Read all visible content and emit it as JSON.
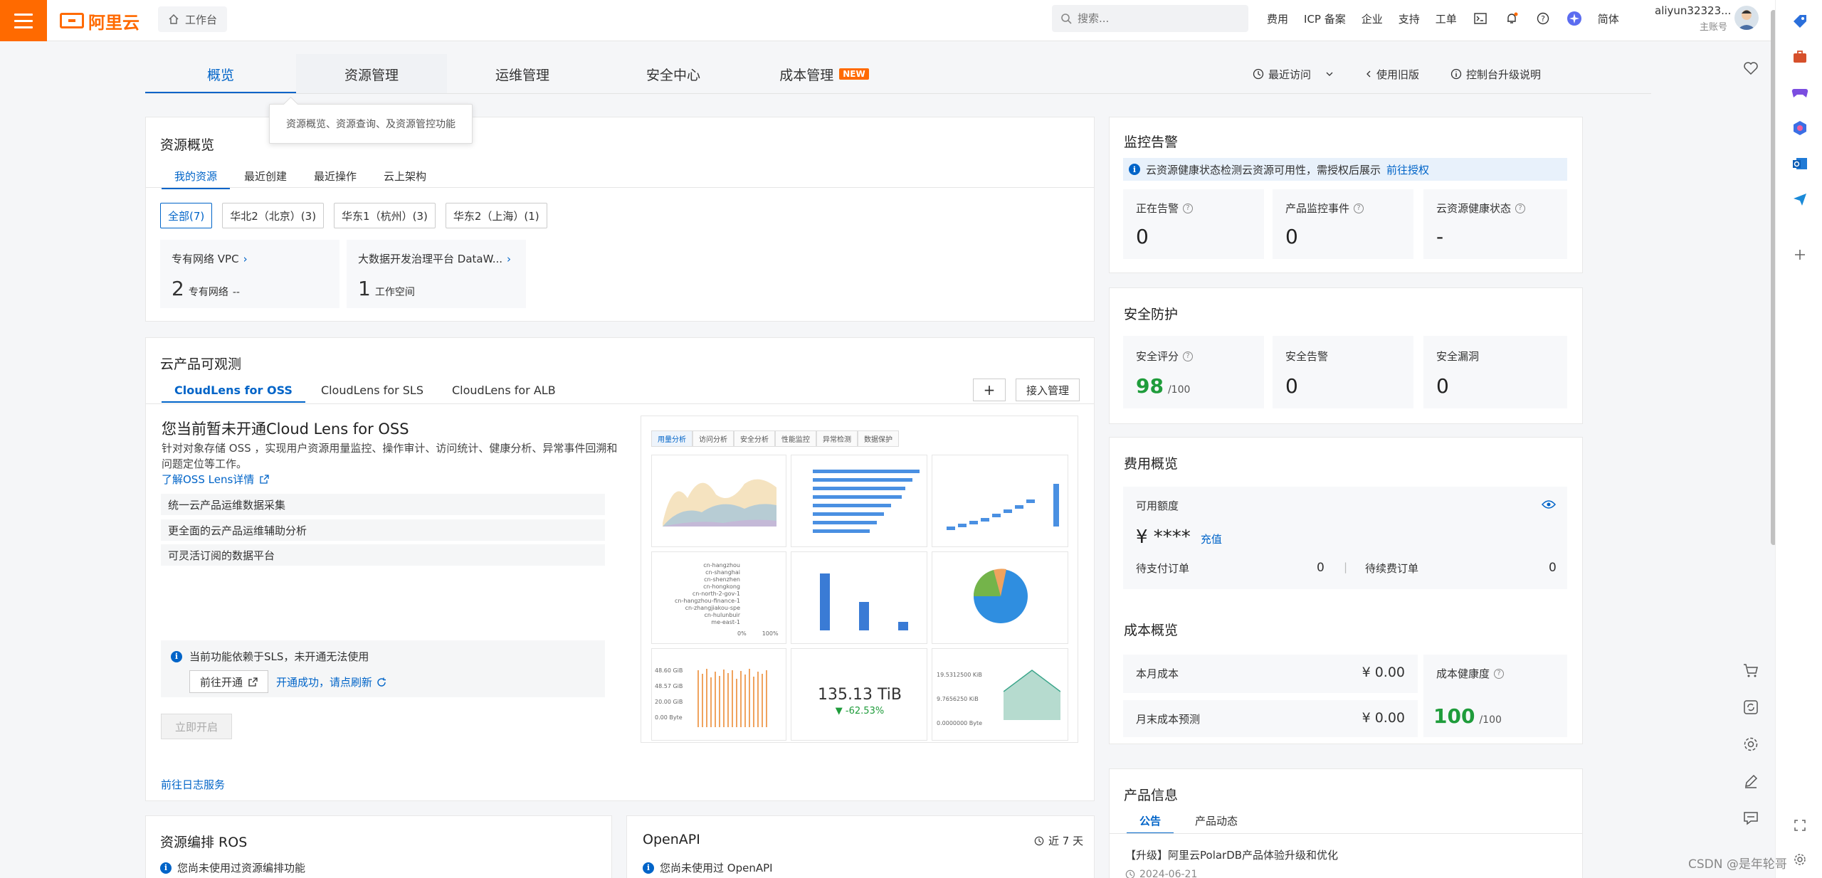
{
  "header": {
    "logo": "阿里云",
    "workbench": "工作台",
    "search_placeholder": "搜索...",
    "nav": [
      "费用",
      "ICP 备案",
      "企业",
      "支持",
      "工单"
    ],
    "lang": "简体",
    "user_name": "aliyun32323...",
    "user_role": "主账号"
  },
  "tabs": [
    {
      "label": "概览"
    },
    {
      "label": "资源管理"
    },
    {
      "label": "运维管理"
    },
    {
      "label": "安全中心"
    },
    {
      "label": "成本管理",
      "badge": "NEW"
    }
  ],
  "right_links": [
    "最近访问",
    "使用旧版",
    "控制台升级说明"
  ],
  "tooltip": "资源概览、资源查询、及资源管控功能",
  "resource": {
    "title": "资源概览",
    "subtabs": [
      "我的资源",
      "最近创建",
      "最近操作",
      "云上架构"
    ],
    "chips": [
      "全部(7)",
      "华北2（北京）(3)",
      "华东1（杭州）(3)",
      "华东2（上海）(1)"
    ],
    "cards": [
      {
        "name": "专有网络 VPC",
        "count": "2",
        "unit": "专有网络",
        "extra": "--"
      },
      {
        "name": "大数据开发治理平台 DataW...",
        "count": "1",
        "unit": "工作空间",
        "extra": ""
      }
    ]
  },
  "observe": {
    "title": "云产品可观测",
    "subtabs": [
      "CloudLens for OSS",
      "CloudLens for SLS",
      "CloudLens for ALB"
    ],
    "plus": "+",
    "manage": "接入管理",
    "heading": "您当前暂未开通Cloud Lens for OSS",
    "desc": "针对对象存储 OSS ，实现用户资源用量监控、操作审计、访问统计、健康分析、异常事件回溯和问题定位等工作。",
    "learn": "了解OSS Lens详情",
    "features": [
      "统一云产品运维数据采集",
      "更全面的云产品运维辅助分析",
      "可灵活订阅的数据平台"
    ],
    "notice": "当前功能依赖于SLS，未开通无法使用",
    "goto": "前往开通",
    "refresh": "开通成功，请点刷新",
    "enable": "立即开启",
    "log_link": "前往日志服务"
  },
  "preview": {
    "tabs": [
      "用量分析",
      "访问分析",
      "安全分析",
      "性能监控",
      "异常检测",
      "数据保护"
    ],
    "big_value": "135.13 TiB",
    "big_change": "▼ -62.53%",
    "y_labels": [
      "48.60 GiB",
      "48.57 GiB",
      "20.00 GiB",
      "0.00 Byte"
    ],
    "y_labels2": [
      "19.5312500 KiB",
      "9.7656250 KiB",
      "0.0000000 Byte"
    ],
    "hbar_labels": [
      "cn-hangzhou",
      "cn-shanghai",
      "cn-shenzhen",
      "cn-hongkong",
      "cn-north-2-gov-1",
      "cn-hangzhou-finance-1",
      "cn-zhangjiakou-spe",
      "cn-hulunbuir",
      "me-east-1"
    ],
    "bottom_axis": [
      "0%",
      "100%"
    ]
  },
  "ros": {
    "title": "资源编排 ROS",
    "note": "您尚未使用过资源编排功能"
  },
  "openapi": {
    "title": "OpenAPI",
    "range": "近 7 天",
    "note": "您尚未使用过 OpenAPI"
  },
  "monitor": {
    "title": "监控告警",
    "banner": "云资源健康状态检测云资源可用性，需授权后展示",
    "banner_link": "前往授权",
    "stats": [
      {
        "label": "正在告警",
        "value": "0"
      },
      {
        "label": "产品监控事件",
        "value": "0"
      },
      {
        "label": "云资源健康状态",
        "value": "-"
      }
    ]
  },
  "security": {
    "title": "安全防护",
    "stats": [
      {
        "label": "安全评分",
        "value": "98",
        "suffix": "/100"
      },
      {
        "label": "安全告警",
        "value": "0",
        "suffix": ""
      },
      {
        "label": "安全漏洞",
        "value": "0",
        "suffix": ""
      }
    ]
  },
  "fee": {
    "title": "费用概览",
    "available": "可用额度",
    "amount": "¥ ****",
    "recharge": "充值",
    "pending": "待支付订单",
    "pending_val": "0",
    "sep": "|",
    "renew": "待续费订单",
    "renew_val": "0"
  },
  "cost": {
    "title": "成本概览",
    "month": "本月成本",
    "month_val": "¥ 0.00",
    "forecast": "月末成本预测",
    "forecast_val": "¥ 0.00",
    "health": "成本健康度",
    "health_val": "100",
    "health_suffix": "/100"
  },
  "product": {
    "title": "产品信息",
    "subtabs": [
      "公告",
      "产品动态"
    ],
    "item": "【升级】阿里云PolarDB产品体验升级和优化",
    "date": "2024-06-21"
  },
  "watermark": "CSDN @是年轮哥",
  "colors": {
    "accent": "#0064c8",
    "brand": "#ff6a00",
    "good": "#1f9c3b"
  }
}
